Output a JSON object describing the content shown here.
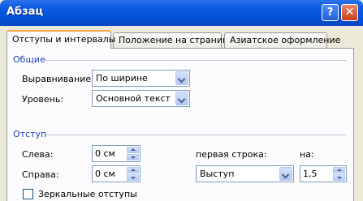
{
  "window": {
    "title": "Абзац",
    "help_label": "?",
    "close_label": "✕"
  },
  "tabs": [
    {
      "label": "Отступы и интервалы",
      "active": true
    },
    {
      "label": "Положение на странице",
      "active": false
    },
    {
      "label": "Азиатское оформление",
      "active": false
    }
  ],
  "general": {
    "title": "Общие",
    "alignment_label": "Выравнивание:",
    "alignment_value": "По ширине",
    "level_label": "Уровень:",
    "level_value": "Основной текст"
  },
  "indent": {
    "title": "Отступ",
    "left_label": "Слева:",
    "left_value": "0 см",
    "right_label": "Справа:",
    "right_value": "0 см",
    "first_line_label": "первая строка:",
    "first_line_value": "Выступ",
    "by_label": "на:",
    "by_value": "1,5",
    "mirror_label": "Зеркальные отступы",
    "mirror_checked": false
  },
  "colors": {
    "section_title": "#1f3fbf",
    "titlebar": "#0450d8",
    "active_tab_accent": "#f1a64a"
  },
  "icons": [
    "help-icon",
    "close-icon",
    "dropdown-arrow-icon",
    "spin-up-icon",
    "spin-down-icon",
    "checkbox-icon"
  ]
}
